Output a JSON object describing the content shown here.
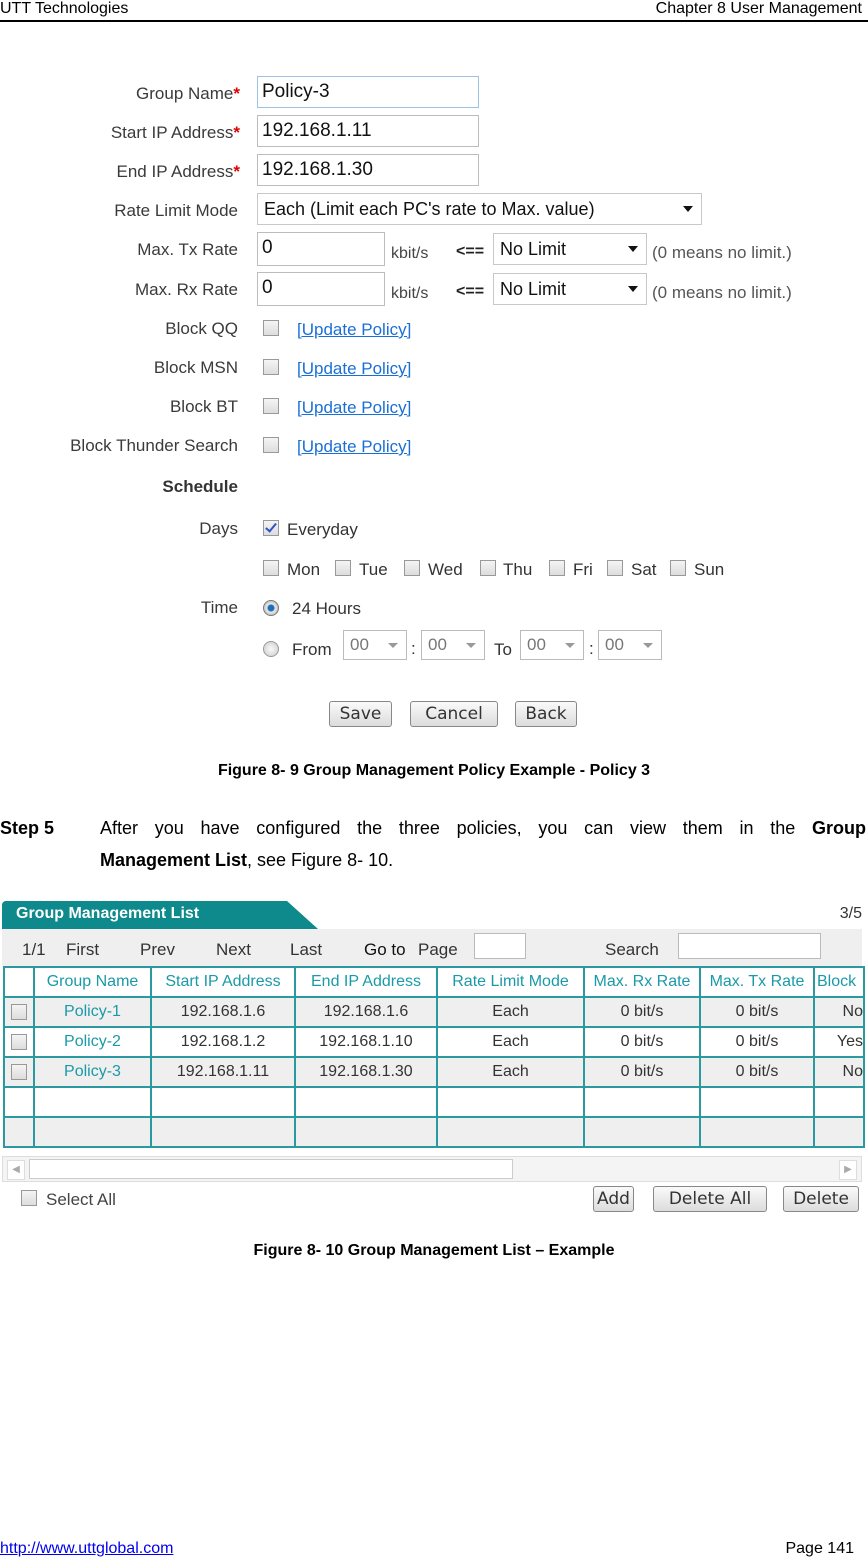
{
  "page_header": {
    "left": "UTT Technologies",
    "right": "Chapter 8 User Management"
  },
  "page_footer": {
    "link": "http://www.uttglobal.com",
    "page": "Page 141"
  },
  "figure9": {
    "form": {
      "group_name": {
        "label": "Group Name",
        "required": "*",
        "value": "Policy-3"
      },
      "start_ip": {
        "label": "Start IP Address",
        "required": "*",
        "value": "192.168.1.11"
      },
      "end_ip": {
        "label": "End IP Address",
        "required": "*",
        "value": "192.168.1.30"
      },
      "rate_limit_mode": {
        "label": "Rate Limit Mode",
        "value": "Each (Limit each PC's rate to Max. value)"
      },
      "max_tx": {
        "label": "Max. Tx Rate",
        "value": "0",
        "unit": "kbit/s",
        "arrow": "<==",
        "preset": "No Limit",
        "note": "(0 means no limit.)"
      },
      "max_rx": {
        "label": "Max. Rx Rate",
        "value": "0",
        "unit": "kbit/s",
        "arrow": "<==",
        "preset": "No Limit",
        "note": "(0 means no limit.)"
      },
      "blocks": [
        {
          "label": "Block QQ",
          "checked": false,
          "link": "[Update Policy]"
        },
        {
          "label": "Block MSN",
          "checked": false,
          "link": "[Update Policy]"
        },
        {
          "label": "Block BT",
          "checked": false,
          "link": "[Update Policy]"
        },
        {
          "label": "Block Thunder Search",
          "checked": false,
          "link": "[Update Policy]"
        }
      ],
      "schedule": {
        "heading": "Schedule",
        "days_label": "Days",
        "everyday": {
          "label": "Everyday",
          "checked": true
        },
        "weekdays": [
          {
            "label": "Mon",
            "checked": false
          },
          {
            "label": "Tue",
            "checked": false
          },
          {
            "label": "Wed",
            "checked": false
          },
          {
            "label": "Thu",
            "checked": false
          },
          {
            "label": "Fri",
            "checked": false
          },
          {
            "label": "Sat",
            "checked": false
          },
          {
            "label": "Sun",
            "checked": false
          }
        ],
        "time_label": "Time",
        "option_24h": {
          "label": "24 Hours",
          "selected": true
        },
        "option_range": {
          "label": "From",
          "selected": false,
          "to_label": "To",
          "separator": ":",
          "from_hour": "00",
          "from_min": "00",
          "to_hour": "00",
          "to_min": "00"
        }
      },
      "buttons": {
        "save": "Save",
        "cancel": "Cancel",
        "back": "Back"
      }
    },
    "caption": "Figure 8- 9 Group Management Policy Example - Policy 3"
  },
  "step5": {
    "label": "Step 5",
    "text_before": "After you have configured the three policies, you can view them in the ",
    "bold1": "Group",
    "bold2": "Management List",
    "text_after": ", see Figure 8- 10."
  },
  "figure10": {
    "title": "Group Management List",
    "count": "3/5",
    "nav": {
      "page_info": "1/1",
      "first": "First",
      "prev": "Prev",
      "next": "Next",
      "last": "Last",
      "goto": "Go to",
      "page_label": "Page",
      "page_value": "",
      "search_label": "Search",
      "search_value": ""
    },
    "columns": [
      "",
      "Group Name",
      "Start IP Address",
      "End IP Address",
      "Rate Limit Mode",
      "Max. Rx Rate",
      "Max. Tx Rate",
      "Block"
    ],
    "rows": [
      {
        "checked": false,
        "name": "Policy-1",
        "start_ip": "192.168.1.6",
        "end_ip": "192.168.1.6",
        "mode": "Each",
        "rx": "0 bit/s",
        "tx": "0 bit/s",
        "block": "No"
      },
      {
        "checked": false,
        "name": "Policy-2",
        "start_ip": "192.168.1.2",
        "end_ip": "192.168.1.10",
        "mode": "Each",
        "rx": "0 bit/s",
        "tx": "0 bit/s",
        "block": "Yes"
      },
      {
        "checked": false,
        "name": "Policy-3",
        "start_ip": "192.168.1.11",
        "end_ip": "192.168.1.30",
        "mode": "Each",
        "rx": "0 bit/s",
        "tx": "0 bit/s",
        "block": "No"
      }
    ],
    "empty_rows": 2,
    "select_all": "Select All",
    "buttons": {
      "add": "Add",
      "delete_all": "Delete All",
      "delete": "Delete"
    },
    "caption": "Figure 8- 10 Group Management List – Example"
  }
}
